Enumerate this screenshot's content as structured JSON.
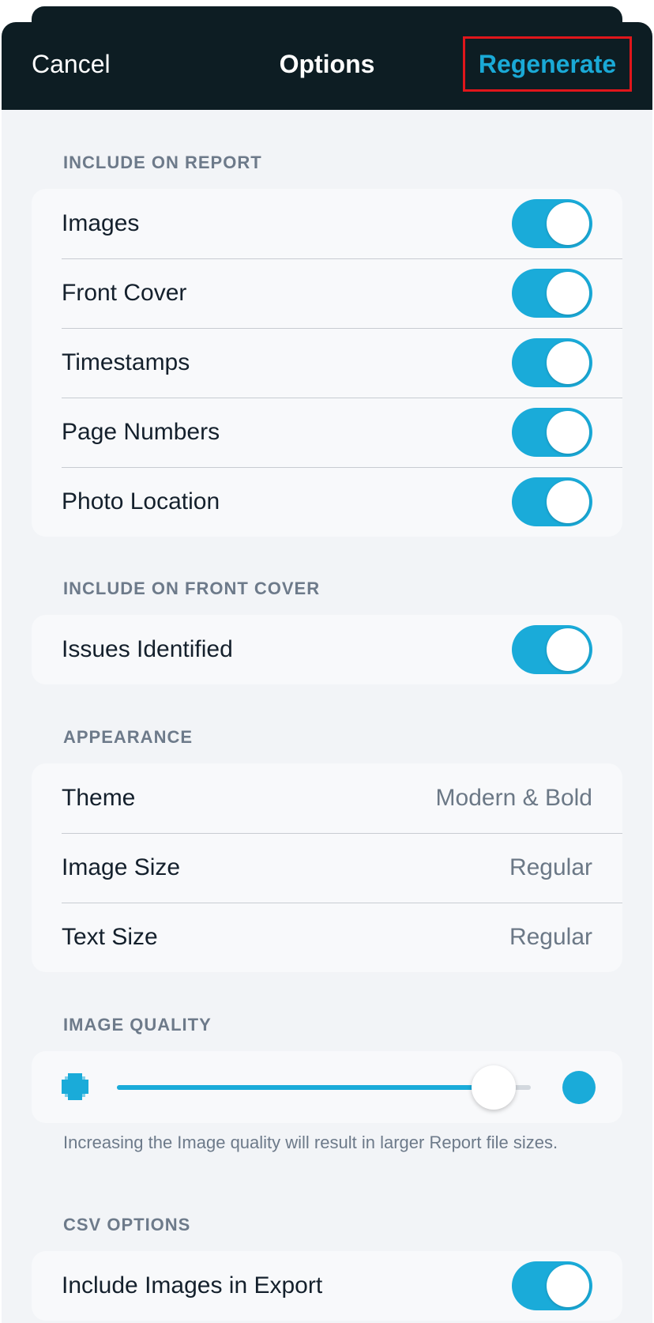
{
  "nav": {
    "cancel": "Cancel",
    "title": "Options",
    "regenerate": "Regenerate"
  },
  "sections": {
    "include_on_report": {
      "header": "INCLUDE ON REPORT",
      "items": [
        {
          "label": "Images",
          "on": true
        },
        {
          "label": "Front Cover",
          "on": true
        },
        {
          "label": "Timestamps",
          "on": true
        },
        {
          "label": "Page Numbers",
          "on": true
        },
        {
          "label": "Photo Location",
          "on": true
        }
      ]
    },
    "include_on_front_cover": {
      "header": "INCLUDE ON FRONT COVER",
      "items": [
        {
          "label": "Issues Identified",
          "on": true
        }
      ]
    },
    "appearance": {
      "header": "APPEARANCE",
      "items": [
        {
          "label": "Theme",
          "value": "Modern & Bold"
        },
        {
          "label": "Image Size",
          "value": "Regular"
        },
        {
          "label": "Text Size",
          "value": "Regular"
        }
      ]
    },
    "image_quality": {
      "header": "IMAGE QUALITY",
      "level": 0.91,
      "footnote": "Increasing the Image quality will result in larger Report file sizes.",
      "icons": {
        "low": "low-quality-pixel-icon",
        "high": "high-quality-dot-icon"
      }
    },
    "csv_options": {
      "header": "CSV OPTIONS",
      "items": [
        {
          "label": "Include Images in Export",
          "on": true
        }
      ]
    }
  },
  "colors": {
    "accent": "#1aabd9",
    "nav_background": "#0d1d23",
    "highlight_box": "#e0161b",
    "page_background": "#f2f4f7"
  }
}
